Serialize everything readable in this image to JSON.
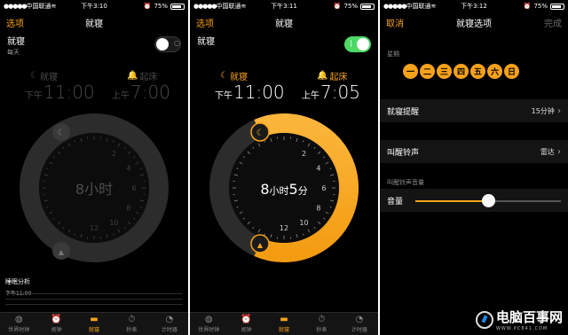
{
  "status_common": {
    "carrier": "中国联通",
    "battery": "75%"
  },
  "screens": [
    {
      "status_time": "下午3:10",
      "nav_left": "选项",
      "nav_title": "就寝",
      "toggle_title": "就寝",
      "toggle_sub": "每天",
      "toggle_on": false,
      "bedtime_label": "就寝",
      "wake_label": "起床",
      "bed_prefix": "下午",
      "bed_time": "11:00",
      "wake_prefix": "上午",
      "wake_time": "7:00",
      "duration": "8小时",
      "analysis_title": "睡眠分析",
      "analysis_sub": "下午11:00"
    },
    {
      "status_time": "下午3:11",
      "nav_left": "选项",
      "nav_title": "就寝",
      "toggle_title": "就寝",
      "toggle_on": true,
      "bedtime_label": "就寝",
      "wake_label": "起床",
      "bed_prefix": "下午",
      "bed_time": "11:00",
      "wake_prefix": "上午",
      "wake_time": "7:05",
      "duration_h": "8",
      "duration_h_unit": "小时",
      "duration_m": "5",
      "duration_m_unit": "分"
    },
    {
      "status_time": "下午3:12",
      "nav_left": "取消",
      "nav_title": "就寝选项",
      "nav_right": "完成",
      "weekdays_label": "星期",
      "weekdays": [
        "一",
        "二",
        "三",
        "四",
        "五",
        "六",
        "日"
      ],
      "reminder_label": "就寝提醒",
      "reminder_value": "15分钟",
      "ringtone_label": "叫醒铃声",
      "ringtone_value": "雷达",
      "volume_section": "叫醒铃声音量",
      "volume_label": "音量",
      "volume_level": 0.5
    }
  ],
  "tabbar": [
    "世界时钟",
    "闹钟",
    "就寝",
    "秒表",
    "计时器"
  ],
  "active_tab": "就寝",
  "clock_numbers": [
    "12",
    "2",
    "4",
    "6",
    "8",
    "10"
  ],
  "watermark": {
    "text": "电脑百事网",
    "sub": "WWW.PC841.COM"
  },
  "colors": {
    "accent": "#f7a21b",
    "toggle_on": "#4cd964",
    "background": "#000000"
  }
}
